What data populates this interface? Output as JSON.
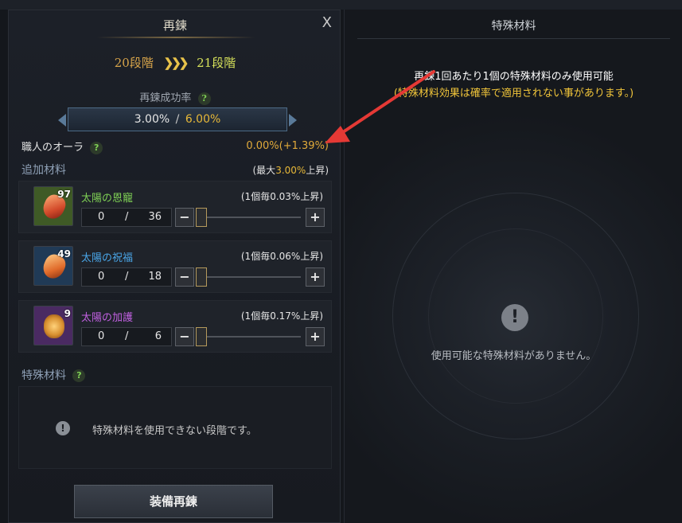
{
  "refine": {
    "title": "再鍊",
    "close_label": "X",
    "stage_from": "20段階",
    "stage_arrows": "❯❯❯",
    "stage_to": "21段階",
    "success_label": "再鍊成功率",
    "help_mark": "?",
    "rate_current": "3.00%",
    "rate_sep": "/",
    "rate_max": "6.00%",
    "aura_label": "職人のオーラ",
    "aura_value": "0.00%(+1.39%)",
    "additional_title": "追加材料",
    "max_note_prefix": "(最大",
    "max_note_value": "3.00%",
    "max_note_suffix": "上昇)",
    "materials": [
      {
        "name": "太陽の恩寵",
        "owned": "97",
        "bonus": "(1個毎0.03%上昇)",
        "qty": "0",
        "slash": "/",
        "max": "36",
        "name_color": "#7fd155",
        "gem_color": "#d24a2a"
      },
      {
        "name": "太陽の祝福",
        "owned": "49",
        "bonus": "(1個毎0.06%上昇)",
        "qty": "0",
        "slash": "/",
        "max": "18",
        "name_color": "#4aa6e8",
        "gem_color": "#e06a2a"
      },
      {
        "name": "太陽の加護",
        "owned": "9",
        "bonus": "(1個毎0.17%上昇)",
        "qty": "0",
        "slash": "/",
        "max": "6",
        "name_color": "#c060e0",
        "gem_color": "#d89030"
      }
    ],
    "minus_label": "−",
    "plus_label": "+",
    "special_title": "特殊材料",
    "special_message": "特殊材料を使用できない段階です。",
    "info_mark": "!",
    "refine_button": "装備再鍊"
  },
  "special_panel": {
    "title": "特殊材料",
    "notice_line1": "再鍊1回あたり1個の特殊材料のみ使用可能",
    "notice_line2": "(特殊材料効果は確率で適用されない事があります。)",
    "empty_message": "使用可能な特殊材料がありません。",
    "info_mark": "!"
  },
  "colors": {
    "annotation_arrow": "#e53935",
    "rate_max": "#e7b838",
    "notice_highlight": "#f0c43a"
  }
}
